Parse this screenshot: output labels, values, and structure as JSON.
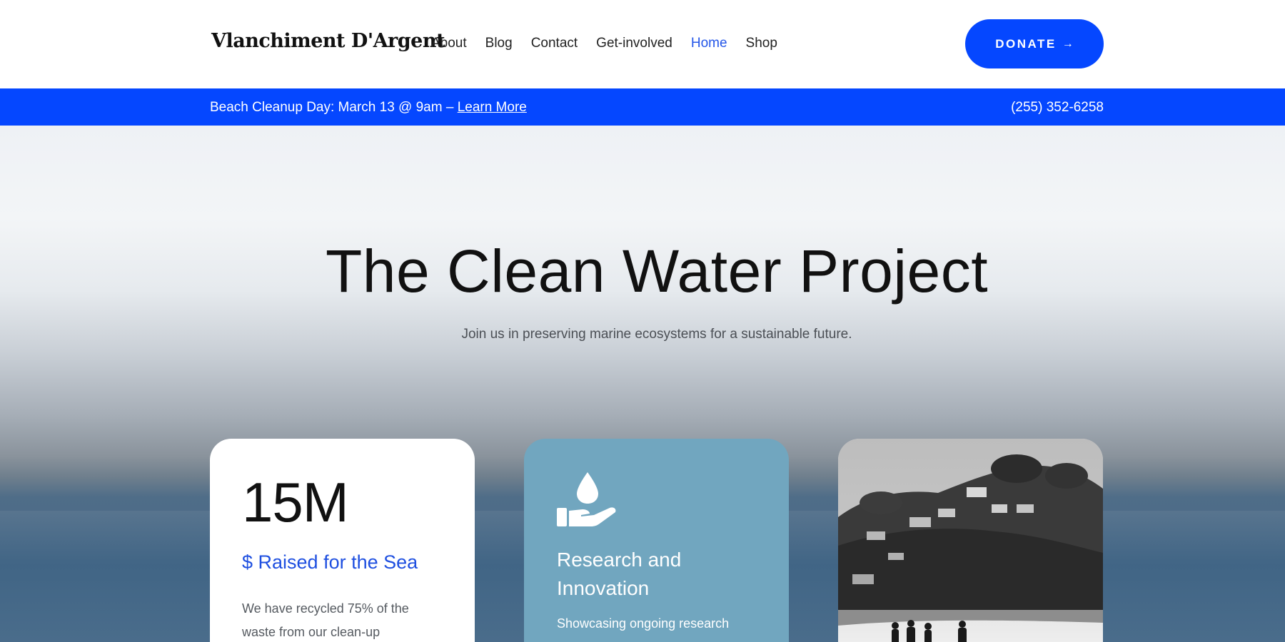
{
  "header": {
    "logo": "Vlanchiment D'Argent",
    "nav": [
      {
        "label": "About",
        "active": false
      },
      {
        "label": "Blog",
        "active": false
      },
      {
        "label": "Contact",
        "active": false
      },
      {
        "label": "Get-involved",
        "active": false
      },
      {
        "label": "Home",
        "active": true
      },
      {
        "label": "Shop",
        "active": false
      }
    ],
    "donate_label": "DONATE",
    "donate_arrow": "→"
  },
  "announcement": {
    "text": "Beach Cleanup Day: March 13 @ 9am – ",
    "link": "Learn More",
    "phone": "(255) 352-6258"
  },
  "hero": {
    "title": "The Clean Water Project",
    "subtitle": "Join us in preserving marine ecosystems for a sustainable future."
  },
  "cards": {
    "stat": {
      "value": "15M",
      "label": "$ Raised for the Sea",
      "description": "We have recycled 75% of the waste from our clean-up"
    },
    "research": {
      "icon": "water-drop-hand-icon",
      "title": "Research and Innovation",
      "description": "Showcasing ongoing research"
    },
    "photo": {
      "icon": "coastal-village-photo"
    }
  },
  "colors": {
    "accent": "#0547ff",
    "active_nav": "#2456e8",
    "research_card": "#71a6bf"
  }
}
